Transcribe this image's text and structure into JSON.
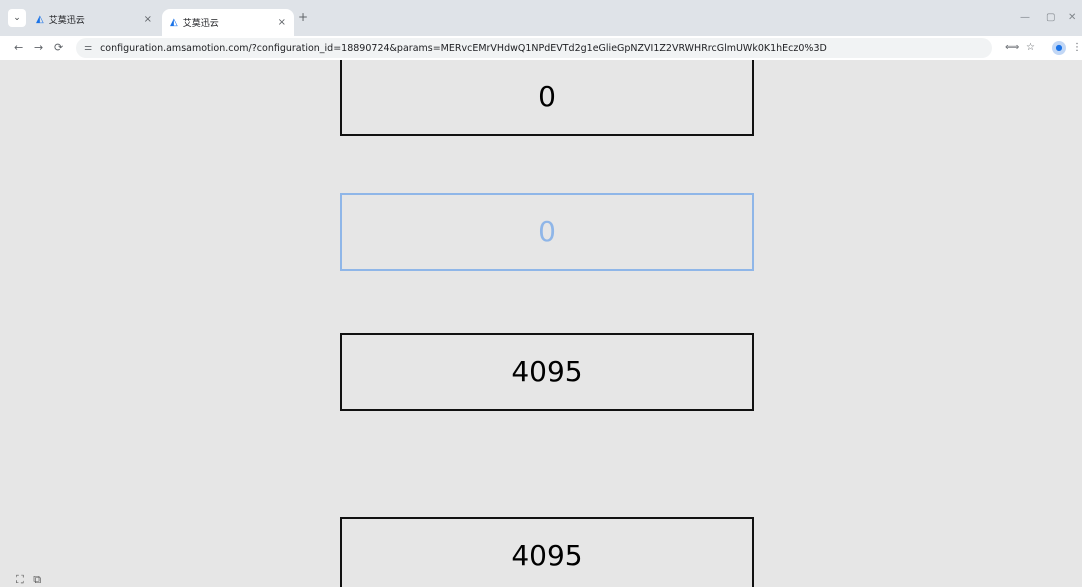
{
  "browser": {
    "tabs": [
      {
        "title": "艾莫迅云",
        "favicon": "cloud-logo-icon",
        "close": "×"
      },
      {
        "title": "艾莫迅云",
        "favicon": "cloud-logo-icon",
        "close": "×",
        "active": true
      }
    ],
    "tab_menu_icon": "⌄",
    "new_tab": "+",
    "window_controls": {
      "minimize": "—",
      "restore": "▢",
      "close": "✕"
    },
    "nav": {
      "back": "←",
      "forward": "→",
      "reload": "⟳"
    },
    "site_info_icon": "⚌",
    "url": "configuration.amsamotion.com/?configuration_id=18890724&params=MERvcEMrVHdwQ1NPdEVTd2g1eGlieGpNZVI1Z2VRWHRrcGlmUWk0K1hEcz0%3D",
    "toolbar_icons": {
      "translate": "⟺",
      "bookmark": "☆",
      "profile": "●",
      "menu": "⋮"
    }
  },
  "content": {
    "boxes": [
      {
        "value": "0",
        "state": "normal"
      },
      {
        "value": "0",
        "state": "focused"
      },
      {
        "value": "4095",
        "state": "normal"
      },
      {
        "value": "4095",
        "state": "normal"
      }
    ],
    "corner_icons": {
      "fullscreen": "⛶",
      "window": "⧉"
    }
  },
  "colors": {
    "focused_border": "#8fb6e8",
    "background": "#e6e6e6"
  }
}
